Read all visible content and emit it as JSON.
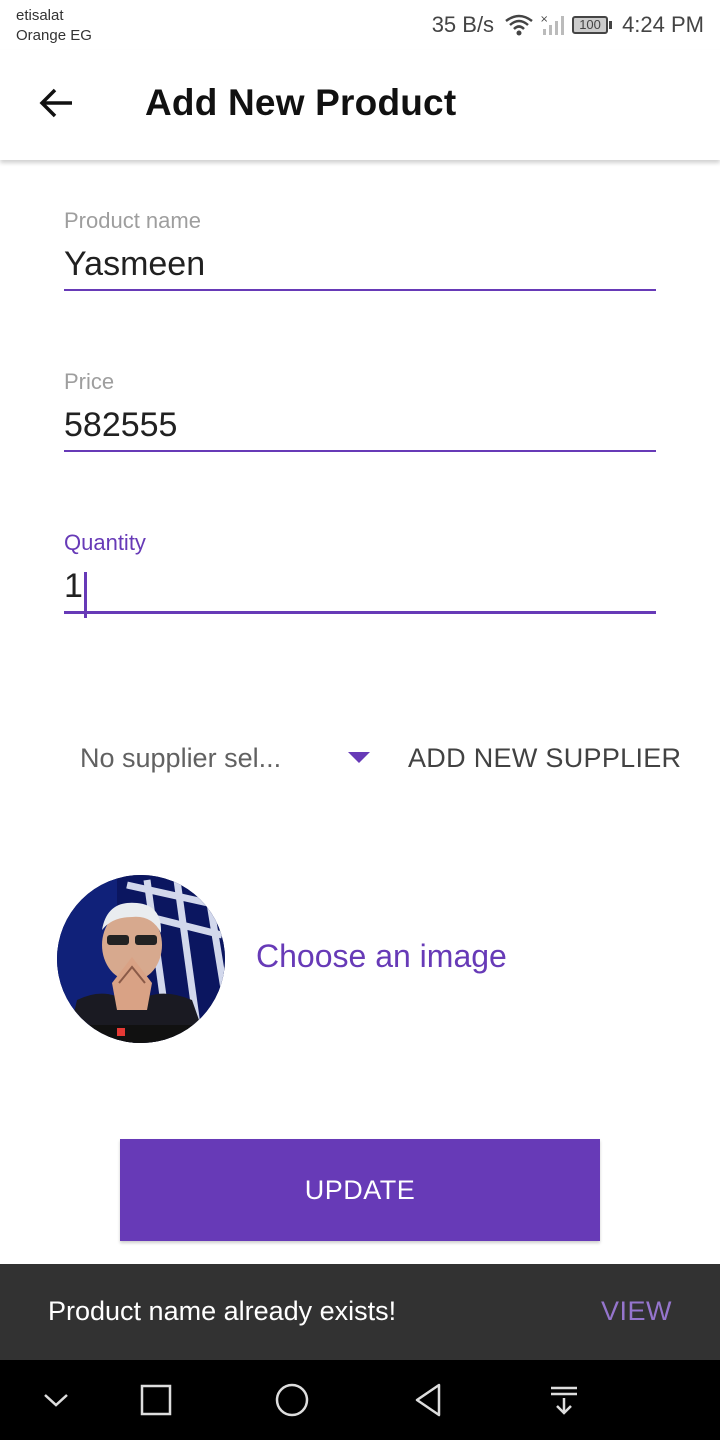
{
  "status_bar": {
    "carrier_line1": "etisalat",
    "carrier_line2": "Orange EG",
    "net_speed": "35 B/s",
    "battery": "100",
    "time": "4:24 PM"
  },
  "app_bar": {
    "title": "Add New Product",
    "back_icon": "arrow-back-icon"
  },
  "form": {
    "product_name": {
      "label": "Product name",
      "value": "Yasmeen"
    },
    "price": {
      "label": "Price",
      "value": "582555"
    },
    "quantity": {
      "label": "Quantity",
      "value": "1"
    }
  },
  "supplier": {
    "selected": "No supplier sel...",
    "add_label": "ADD NEW SUPPLIER"
  },
  "image_picker": {
    "label": "Choose an image"
  },
  "update_label": "UPDATE",
  "snackbar": {
    "message": "Product name already exists!",
    "action": "VIEW"
  },
  "colors": {
    "accent": "#673ab7",
    "snackbar_bg": "#323232",
    "snackbar_action": "#9575cd"
  },
  "nav_icons": [
    "chevron-down-icon",
    "recents-square-icon",
    "home-circle-icon",
    "back-triangle-icon",
    "notification-pull-icon"
  ]
}
